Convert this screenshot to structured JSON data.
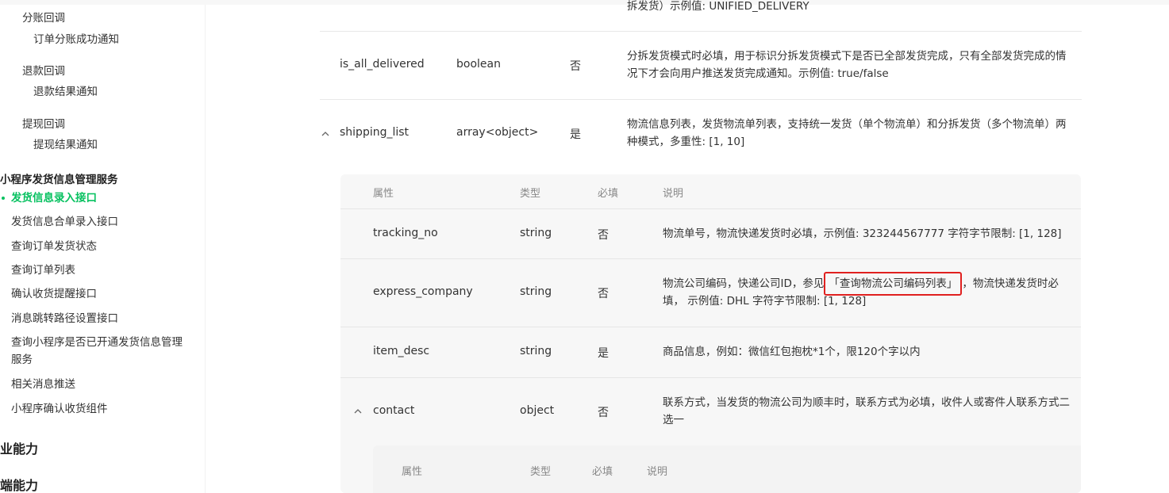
{
  "sidebar": {
    "items": [
      {
        "label": "分账回调"
      },
      {
        "label": "订单分账成功通知"
      },
      {
        "label": "退款回调"
      },
      {
        "label": "退款结果通知"
      },
      {
        "label": "提现回调"
      },
      {
        "label": "提现结果通知"
      },
      {
        "label": "小程序发货信息管理服务"
      },
      {
        "label": "发货信息录入接口"
      },
      {
        "label": "发货信息合单录入接口"
      },
      {
        "label": "查询订单发货状态"
      },
      {
        "label": "查询订单列表"
      },
      {
        "label": "确认收货提醒接口"
      },
      {
        "label": "消息跳转路径设置接口"
      },
      {
        "label": "查询小程序是否已开通发货信息管理服务"
      },
      {
        "label": "相关消息推送"
      },
      {
        "label": "小程序确认收货组件"
      },
      {
        "label": "业能力"
      },
      {
        "label": "端能力"
      }
    ]
  },
  "main": {
    "partial_top_text": "拆发货）示例值: UNIFIED_DELIVERY",
    "rows": [
      {
        "name": "is_all_delivered",
        "type": "boolean",
        "required": "否",
        "desc": "分拆发货模式时必填，用于标识分拆发货模式下是否已全部发货完成，只有全部发货完成的情况下才会向用户推送发货完成通知。示例值: true/false"
      },
      {
        "name": "shipping_list",
        "type": "array<object>",
        "required": "是",
        "desc": "物流信息列表，发货物流单列表，支持统一发货（单个物流单）和分拆发货（多个物流单）两种模式，多重性: [1, 10]"
      }
    ],
    "nested": {
      "headers": {
        "attr": "属性",
        "type": "类型",
        "required": "必填",
        "desc": "说明"
      },
      "rows": [
        {
          "name": "tracking_no",
          "type": "string",
          "required": "否",
          "desc": "物流单号，物流快递发货时必填，示例值: 323244567777 字符字节限制: [1, 128]"
        },
        {
          "name": "express_company",
          "type": "string",
          "required": "否",
          "desc_before": "物流公司编码，快递公司ID，参见",
          "desc_link": "「查询物流公司编码列表」",
          "desc_after": "，物流快递发货时必填， 示例值: DHL 字符字节限制: [1, 128]"
        },
        {
          "name": "item_desc",
          "type": "string",
          "required": "是",
          "desc": "商品信息，例如：微信红包抱枕*1个，限120个字以内"
        },
        {
          "name": "contact",
          "type": "object",
          "required": "否",
          "desc": "联系方式，当发货的物流公司为顺丰时，联系方式为必填，收件人或寄件人联系方式二选一"
        }
      ],
      "sub_headers": {
        "attr": "属性",
        "type": "类型",
        "required": "必填",
        "desc": "说明"
      }
    }
  },
  "colors": {
    "accent": "#07c160",
    "highlight_border": "#e0201f"
  }
}
